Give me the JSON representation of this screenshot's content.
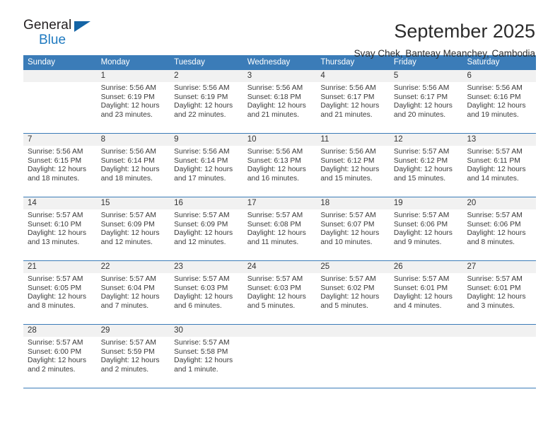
{
  "brand": {
    "name_top": "General",
    "name_bottom": "Blue",
    "triangle_color": "#1464a5",
    "blue_color": "#1f7ac0"
  },
  "header": {
    "title": "September 2025",
    "subtitle": "Svay Chek, Banteay Meanchey, Cambodia"
  },
  "theme": {
    "header_blue": "#3b7cb8",
    "daynum_band": "#f1f1f1",
    "text": "#3a3a3a"
  },
  "weekday_headers": [
    "Sunday",
    "Monday",
    "Tuesday",
    "Wednesday",
    "Thursday",
    "Friday",
    "Saturday"
  ],
  "weeks": [
    [
      {
        "day": "",
        "sunrise": "",
        "sunset": "",
        "daylight_1": "",
        "daylight_2": ""
      },
      {
        "day": "1",
        "sunrise": "Sunrise: 5:56 AM",
        "sunset": "Sunset: 6:19 PM",
        "daylight_1": "Daylight: 12 hours",
        "daylight_2": "and 23 minutes."
      },
      {
        "day": "2",
        "sunrise": "Sunrise: 5:56 AM",
        "sunset": "Sunset: 6:19 PM",
        "daylight_1": "Daylight: 12 hours",
        "daylight_2": "and 22 minutes."
      },
      {
        "day": "3",
        "sunrise": "Sunrise: 5:56 AM",
        "sunset": "Sunset: 6:18 PM",
        "daylight_1": "Daylight: 12 hours",
        "daylight_2": "and 21 minutes."
      },
      {
        "day": "4",
        "sunrise": "Sunrise: 5:56 AM",
        "sunset": "Sunset: 6:17 PM",
        "daylight_1": "Daylight: 12 hours",
        "daylight_2": "and 21 minutes."
      },
      {
        "day": "5",
        "sunrise": "Sunrise: 5:56 AM",
        "sunset": "Sunset: 6:17 PM",
        "daylight_1": "Daylight: 12 hours",
        "daylight_2": "and 20 minutes."
      },
      {
        "day": "6",
        "sunrise": "Sunrise: 5:56 AM",
        "sunset": "Sunset: 6:16 PM",
        "daylight_1": "Daylight: 12 hours",
        "daylight_2": "and 19 minutes."
      }
    ],
    [
      {
        "day": "7",
        "sunrise": "Sunrise: 5:56 AM",
        "sunset": "Sunset: 6:15 PM",
        "daylight_1": "Daylight: 12 hours",
        "daylight_2": "and 18 minutes."
      },
      {
        "day": "8",
        "sunrise": "Sunrise: 5:56 AM",
        "sunset": "Sunset: 6:14 PM",
        "daylight_1": "Daylight: 12 hours",
        "daylight_2": "and 18 minutes."
      },
      {
        "day": "9",
        "sunrise": "Sunrise: 5:56 AM",
        "sunset": "Sunset: 6:14 PM",
        "daylight_1": "Daylight: 12 hours",
        "daylight_2": "and 17 minutes."
      },
      {
        "day": "10",
        "sunrise": "Sunrise: 5:56 AM",
        "sunset": "Sunset: 6:13 PM",
        "daylight_1": "Daylight: 12 hours",
        "daylight_2": "and 16 minutes."
      },
      {
        "day": "11",
        "sunrise": "Sunrise: 5:56 AM",
        "sunset": "Sunset: 6:12 PM",
        "daylight_1": "Daylight: 12 hours",
        "daylight_2": "and 15 minutes."
      },
      {
        "day": "12",
        "sunrise": "Sunrise: 5:57 AM",
        "sunset": "Sunset: 6:12 PM",
        "daylight_1": "Daylight: 12 hours",
        "daylight_2": "and 15 minutes."
      },
      {
        "day": "13",
        "sunrise": "Sunrise: 5:57 AM",
        "sunset": "Sunset: 6:11 PM",
        "daylight_1": "Daylight: 12 hours",
        "daylight_2": "and 14 minutes."
      }
    ],
    [
      {
        "day": "14",
        "sunrise": "Sunrise: 5:57 AM",
        "sunset": "Sunset: 6:10 PM",
        "daylight_1": "Daylight: 12 hours",
        "daylight_2": "and 13 minutes."
      },
      {
        "day": "15",
        "sunrise": "Sunrise: 5:57 AM",
        "sunset": "Sunset: 6:09 PM",
        "daylight_1": "Daylight: 12 hours",
        "daylight_2": "and 12 minutes."
      },
      {
        "day": "16",
        "sunrise": "Sunrise: 5:57 AM",
        "sunset": "Sunset: 6:09 PM",
        "daylight_1": "Daylight: 12 hours",
        "daylight_2": "and 12 minutes."
      },
      {
        "day": "17",
        "sunrise": "Sunrise: 5:57 AM",
        "sunset": "Sunset: 6:08 PM",
        "daylight_1": "Daylight: 12 hours",
        "daylight_2": "and 11 minutes."
      },
      {
        "day": "18",
        "sunrise": "Sunrise: 5:57 AM",
        "sunset": "Sunset: 6:07 PM",
        "daylight_1": "Daylight: 12 hours",
        "daylight_2": "and 10 minutes."
      },
      {
        "day": "19",
        "sunrise": "Sunrise: 5:57 AM",
        "sunset": "Sunset: 6:06 PM",
        "daylight_1": "Daylight: 12 hours",
        "daylight_2": "and 9 minutes."
      },
      {
        "day": "20",
        "sunrise": "Sunrise: 5:57 AM",
        "sunset": "Sunset: 6:06 PM",
        "daylight_1": "Daylight: 12 hours",
        "daylight_2": "and 8 minutes."
      }
    ],
    [
      {
        "day": "21",
        "sunrise": "Sunrise: 5:57 AM",
        "sunset": "Sunset: 6:05 PM",
        "daylight_1": "Daylight: 12 hours",
        "daylight_2": "and 8 minutes."
      },
      {
        "day": "22",
        "sunrise": "Sunrise: 5:57 AM",
        "sunset": "Sunset: 6:04 PM",
        "daylight_1": "Daylight: 12 hours",
        "daylight_2": "and 7 minutes."
      },
      {
        "day": "23",
        "sunrise": "Sunrise: 5:57 AM",
        "sunset": "Sunset: 6:03 PM",
        "daylight_1": "Daylight: 12 hours",
        "daylight_2": "and 6 minutes."
      },
      {
        "day": "24",
        "sunrise": "Sunrise: 5:57 AM",
        "sunset": "Sunset: 6:03 PM",
        "daylight_1": "Daylight: 12 hours",
        "daylight_2": "and 5 minutes."
      },
      {
        "day": "25",
        "sunrise": "Sunrise: 5:57 AM",
        "sunset": "Sunset: 6:02 PM",
        "daylight_1": "Daylight: 12 hours",
        "daylight_2": "and 5 minutes."
      },
      {
        "day": "26",
        "sunrise": "Sunrise: 5:57 AM",
        "sunset": "Sunset: 6:01 PM",
        "daylight_1": "Daylight: 12 hours",
        "daylight_2": "and 4 minutes."
      },
      {
        "day": "27",
        "sunrise": "Sunrise: 5:57 AM",
        "sunset": "Sunset: 6:01 PM",
        "daylight_1": "Daylight: 12 hours",
        "daylight_2": "and 3 minutes."
      }
    ],
    [
      {
        "day": "28",
        "sunrise": "Sunrise: 5:57 AM",
        "sunset": "Sunset: 6:00 PM",
        "daylight_1": "Daylight: 12 hours",
        "daylight_2": "and 2 minutes."
      },
      {
        "day": "29",
        "sunrise": "Sunrise: 5:57 AM",
        "sunset": "Sunset: 5:59 PM",
        "daylight_1": "Daylight: 12 hours",
        "daylight_2": "and 2 minutes."
      },
      {
        "day": "30",
        "sunrise": "Sunrise: 5:57 AM",
        "sunset": "Sunset: 5:58 PM",
        "daylight_1": "Daylight: 12 hours",
        "daylight_2": "and 1 minute."
      },
      {
        "day": "",
        "sunrise": "",
        "sunset": "",
        "daylight_1": "",
        "daylight_2": ""
      },
      {
        "day": "",
        "sunrise": "",
        "sunset": "",
        "daylight_1": "",
        "daylight_2": ""
      },
      {
        "day": "",
        "sunrise": "",
        "sunset": "",
        "daylight_1": "",
        "daylight_2": ""
      },
      {
        "day": "",
        "sunrise": "",
        "sunset": "",
        "daylight_1": "",
        "daylight_2": ""
      }
    ]
  ]
}
